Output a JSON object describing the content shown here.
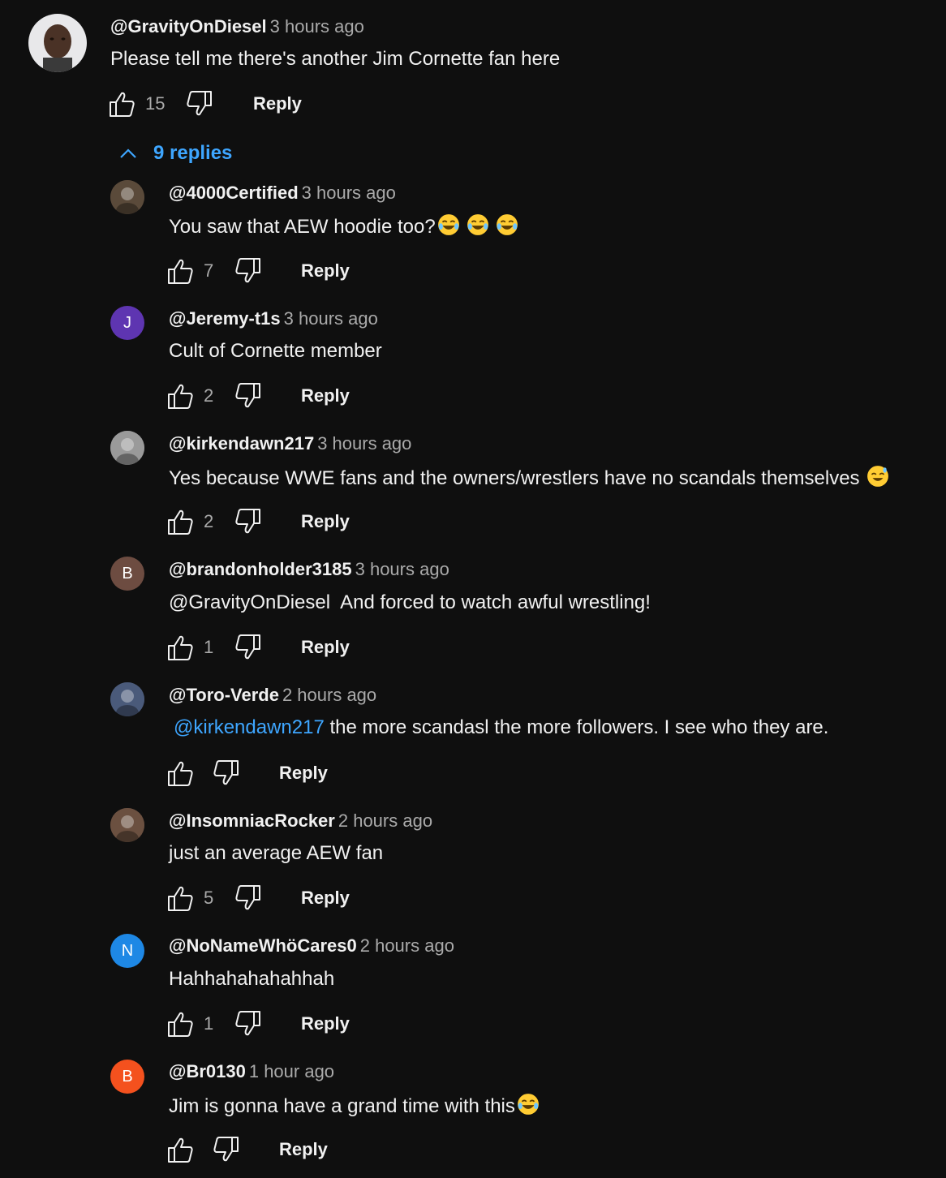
{
  "top_comment": {
    "author": "@GravityOnDiesel",
    "time": "3 hours ago",
    "text": "Please tell me there's another Jim Cornette fan here",
    "likes": "15",
    "reply_label": "Reply",
    "replies_toggle": "9 replies"
  },
  "replies": [
    {
      "author": "@4000Certified",
      "time": "3 hours ago",
      "text": "You saw that AEW hoodie too?",
      "emojis": [
        "joy",
        "joy",
        "joy"
      ],
      "likes": "7",
      "reply_label": "Reply",
      "avatar": {
        "type": "photo",
        "color": "#5a4a3a"
      }
    },
    {
      "author": "@Jeremy-t1s",
      "time": "3 hours ago",
      "text": "Cult of Cornette member",
      "likes": "2",
      "reply_label": "Reply",
      "avatar": {
        "type": "letter",
        "letter": "J",
        "color": "#5e35b1"
      }
    },
    {
      "author": "@kirkendawn217",
      "time": "3 hours ago",
      "text": "Yes because WWE fans and the owners/wrestlers have no scandals themselves ",
      "emojis": [
        "sweat-smile"
      ],
      "likes": "2",
      "reply_label": "Reply",
      "avatar": {
        "type": "photo",
        "color": "#9a9a9a"
      }
    },
    {
      "author": "@brandonholder3185",
      "time": "3 hours ago",
      "text": "@GravityOnDiesel  And forced to watch awful wrestling!",
      "likes": "1",
      "reply_label": "Reply",
      "avatar": {
        "type": "letter",
        "letter": "B",
        "color": "#6d4c41"
      }
    },
    {
      "author": "@Toro-Verde",
      "time": "2 hours ago",
      "mention": "@kirkendawn217",
      "text": " the more scandasl the more followers. I see who they are.",
      "likes": "",
      "reply_label": "Reply",
      "avatar": {
        "type": "photo",
        "color": "#4a5a7a"
      }
    },
    {
      "author": "@InsomniacRocker",
      "time": "2 hours ago",
      "text": "just an average AEW fan",
      "likes": "5",
      "reply_label": "Reply",
      "avatar": {
        "type": "photo",
        "color": "#6b5040"
      }
    },
    {
      "author": "@NoNameWhöCares0",
      "time": "2 hours ago",
      "text": "Hahhahahahahhah",
      "likes": "1",
      "reply_label": "Reply",
      "avatar": {
        "type": "letter",
        "letter": "N",
        "color": "#1e88e5"
      }
    },
    {
      "author": "@Br0130",
      "time": "1 hour ago",
      "text": "Jim is gonna have a grand time with this",
      "emojis": [
        "joy"
      ],
      "likes": "",
      "reply_label": "Reply",
      "avatar": {
        "type": "letter",
        "letter": "B",
        "color": "#f4511e"
      }
    }
  ]
}
